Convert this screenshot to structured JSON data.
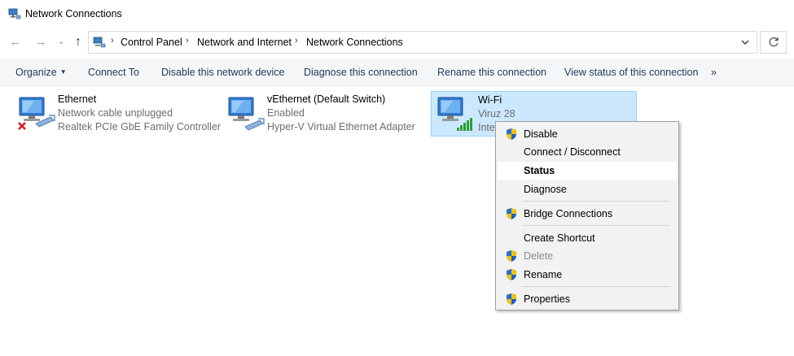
{
  "window": {
    "title": "Network Connections"
  },
  "navigation": {
    "back_glyph": "←",
    "forward_glyph": "→",
    "recent_glyph": "⌄",
    "up_glyph": "↑",
    "breadcrumbs": [
      "Control Panel",
      "Network and Internet",
      "Network Connections"
    ],
    "separator": "›"
  },
  "toolbar": {
    "commands": [
      "Organize",
      "Connect To",
      "Disable this network device",
      "Diagnose this connection",
      "Rename this connection",
      "View status of this connection"
    ],
    "more": "»",
    "organize_caret": "▼"
  },
  "connections": [
    {
      "name": "Ethernet",
      "status": "Network cable unplugged",
      "device": "Realtek PCIe GbE Family Controller",
      "icon": "ethernet-disconnected-icon"
    },
    {
      "name": "vEthernet (Default Switch)",
      "status": "Enabled",
      "device": "Hyper-V Virtual Ethernet Adapter",
      "icon": "ethernet-icon"
    },
    {
      "name": "Wi-Fi",
      "status": "Viruz 28",
      "device": "Inte",
      "icon": "wifi-signal-icon",
      "selected": true
    }
  ],
  "context_menu": {
    "items": [
      {
        "label": "Disable",
        "shield": true
      },
      {
        "label": "Connect / Disconnect",
        "shield": false
      },
      {
        "label": "Status",
        "shield": false,
        "bold": true
      },
      {
        "label": "Diagnose",
        "shield": false
      },
      {
        "label": "Bridge Connections",
        "shield": true
      },
      {
        "label": "Create Shortcut",
        "shield": false
      },
      {
        "label": "Delete",
        "shield": true,
        "disabled": true
      },
      {
        "label": "Rename",
        "shield": true
      },
      {
        "label": "Properties",
        "shield": true
      }
    ]
  },
  "colors": {
    "command_text": "#1e395b",
    "selection_fill": "#cce8ff",
    "selection_border": "#99d1ff",
    "menu_background": "#f2f2f2",
    "secondary_text": "#6d6d6d"
  }
}
